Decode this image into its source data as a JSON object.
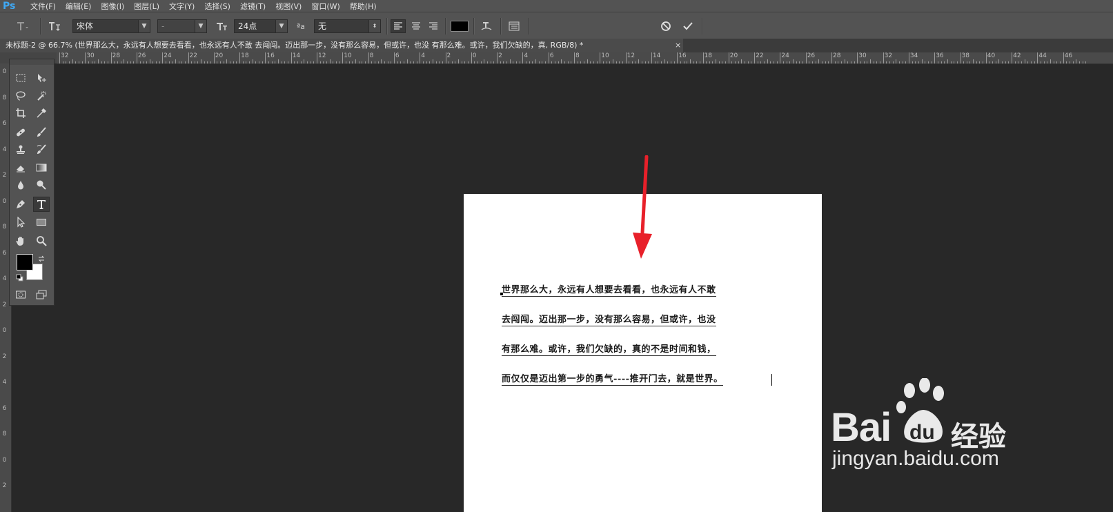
{
  "app": {
    "logo": "Ps",
    "menu": [
      "文件(F)",
      "编辑(E)",
      "图像(I)",
      "图层(L)",
      "文字(Y)",
      "选择(S)",
      "滤镜(T)",
      "视图(V)",
      "窗口(W)",
      "帮助(H)"
    ]
  },
  "options": {
    "font_family": "宋体",
    "font_style": "-",
    "font_size": "24点",
    "aa_glyph": "ªa",
    "anti_alias": "无",
    "text_color": "#000000"
  },
  "document": {
    "tab_title": "未标题-2 @ 66.7% (世界那么大，永远有人想要去看看，也永远有人不敢 去闯闯。迈出那一步，没有那么容易，但或许，也没 有那么难。或许，我们欠缺的，真, RGB/8) *",
    "tab_close": "×"
  },
  "rulers": {
    "top": [
      "32",
      "30",
      "28",
      "26",
      "24",
      "22",
      "20",
      "18",
      "16",
      "14",
      "12",
      "10",
      "8",
      "6",
      "4",
      "2",
      "0",
      "2",
      "4",
      "6",
      "8",
      "10",
      "12",
      "14",
      "16",
      "18",
      "20",
      "22",
      "24",
      "26",
      "28",
      "30",
      "32",
      "34",
      "36",
      "38",
      "40",
      "42",
      "44",
      "46"
    ],
    "left": [
      "0",
      "8",
      "6",
      "4",
      "2",
      "0",
      "8",
      "6",
      "4",
      "2",
      "0",
      "2",
      "4",
      "6",
      "8",
      "0",
      "2"
    ]
  },
  "canvas": {
    "lines": [
      "世界那么大，永远有人想要去看看，也永远有人不敢",
      "去闯闯。迈出那一步，没有那么容易，但或许，也没",
      "有那么难。或许，我们欠缺的，真的不是时间和钱，",
      "而仅仅是迈出第一步的勇气----推开门去，就是世界。"
    ]
  },
  "watermark": {
    "brand": "Bai",
    "brand_du": "du",
    "jingyan": "经验",
    "url": "jingyan.baidu.com"
  },
  "colors": {
    "arrow": "#e8202a",
    "chrome": "#535353",
    "workspace": "#282828"
  }
}
